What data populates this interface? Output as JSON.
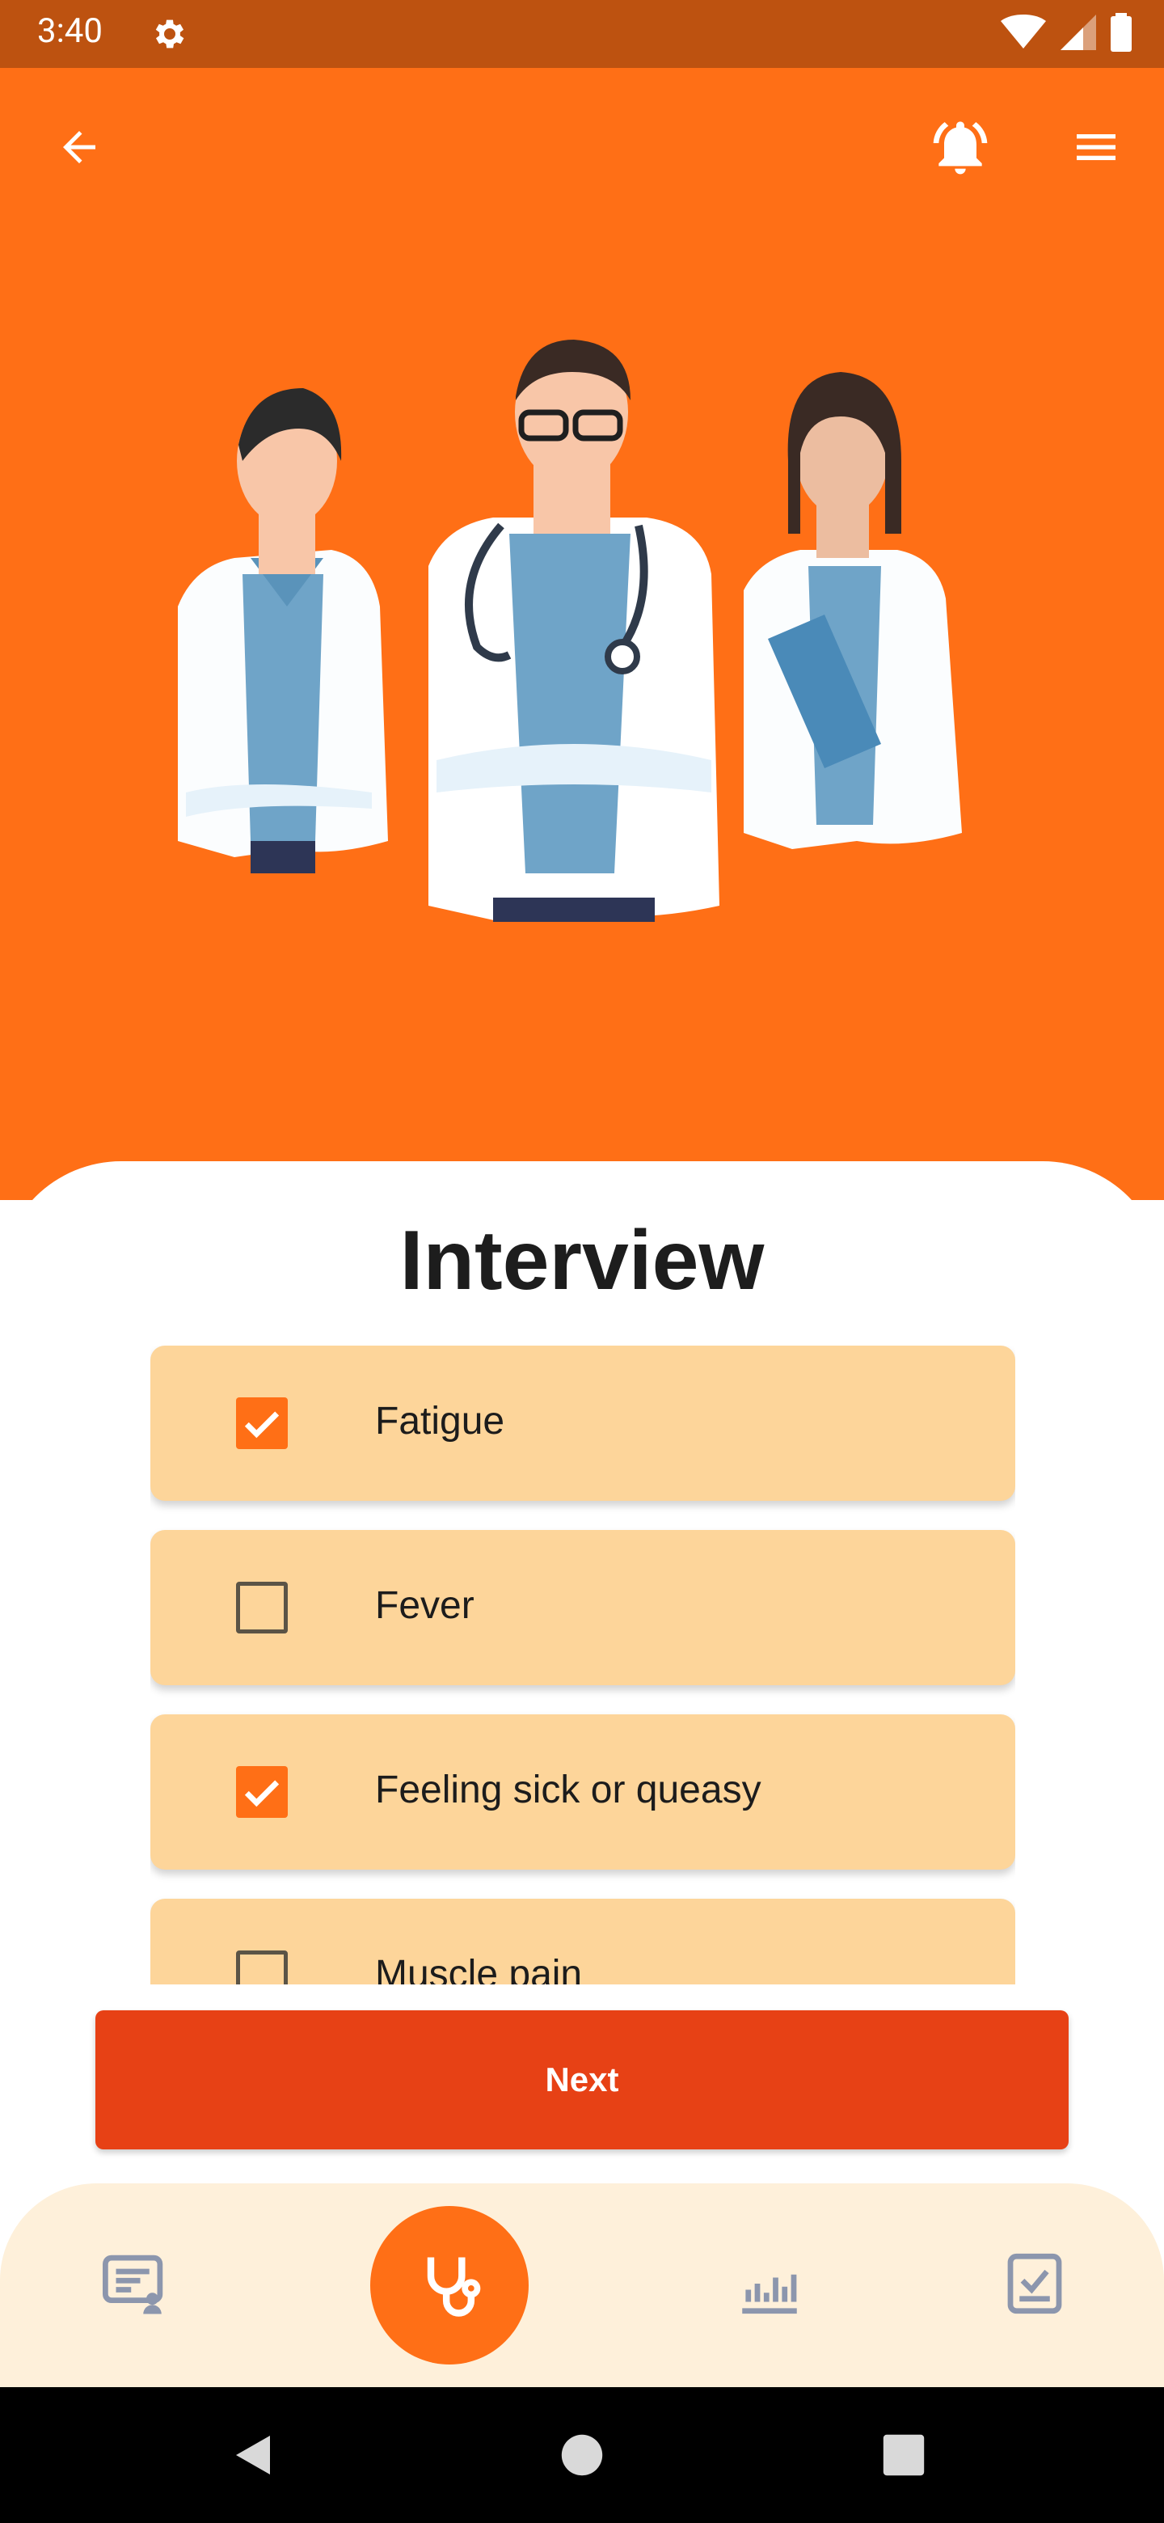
{
  "status_bar": {
    "time": "3:40",
    "icons": [
      "gear-icon",
      "wifi-icon",
      "signal-icon",
      "battery-icon"
    ]
  },
  "app_bar": {
    "icons": [
      "back-arrow-icon",
      "notification-bell-icon",
      "hamburger-menu-icon"
    ]
  },
  "hero": {
    "illustration": "three-doctors-illustration"
  },
  "interview": {
    "title": "Interview",
    "items": [
      {
        "label": "Fatigue",
        "checked": true
      },
      {
        "label": "Fever",
        "checked": false
      },
      {
        "label": "Feeling sick or queasy",
        "checked": true
      },
      {
        "label": "Muscle pain",
        "checked": false
      }
    ]
  },
  "next_label": "Next",
  "bottom_nav": {
    "items": [
      "report-icon",
      "stethoscope-icon",
      "chart-icon",
      "checklist-icon"
    ],
    "active": "stethoscope-icon"
  },
  "colors": {
    "primary": "#ff6f16",
    "status_bar": "#bd5210",
    "card": "#fdd59a",
    "button": "#e74115",
    "nav_background": "#fef0da"
  }
}
